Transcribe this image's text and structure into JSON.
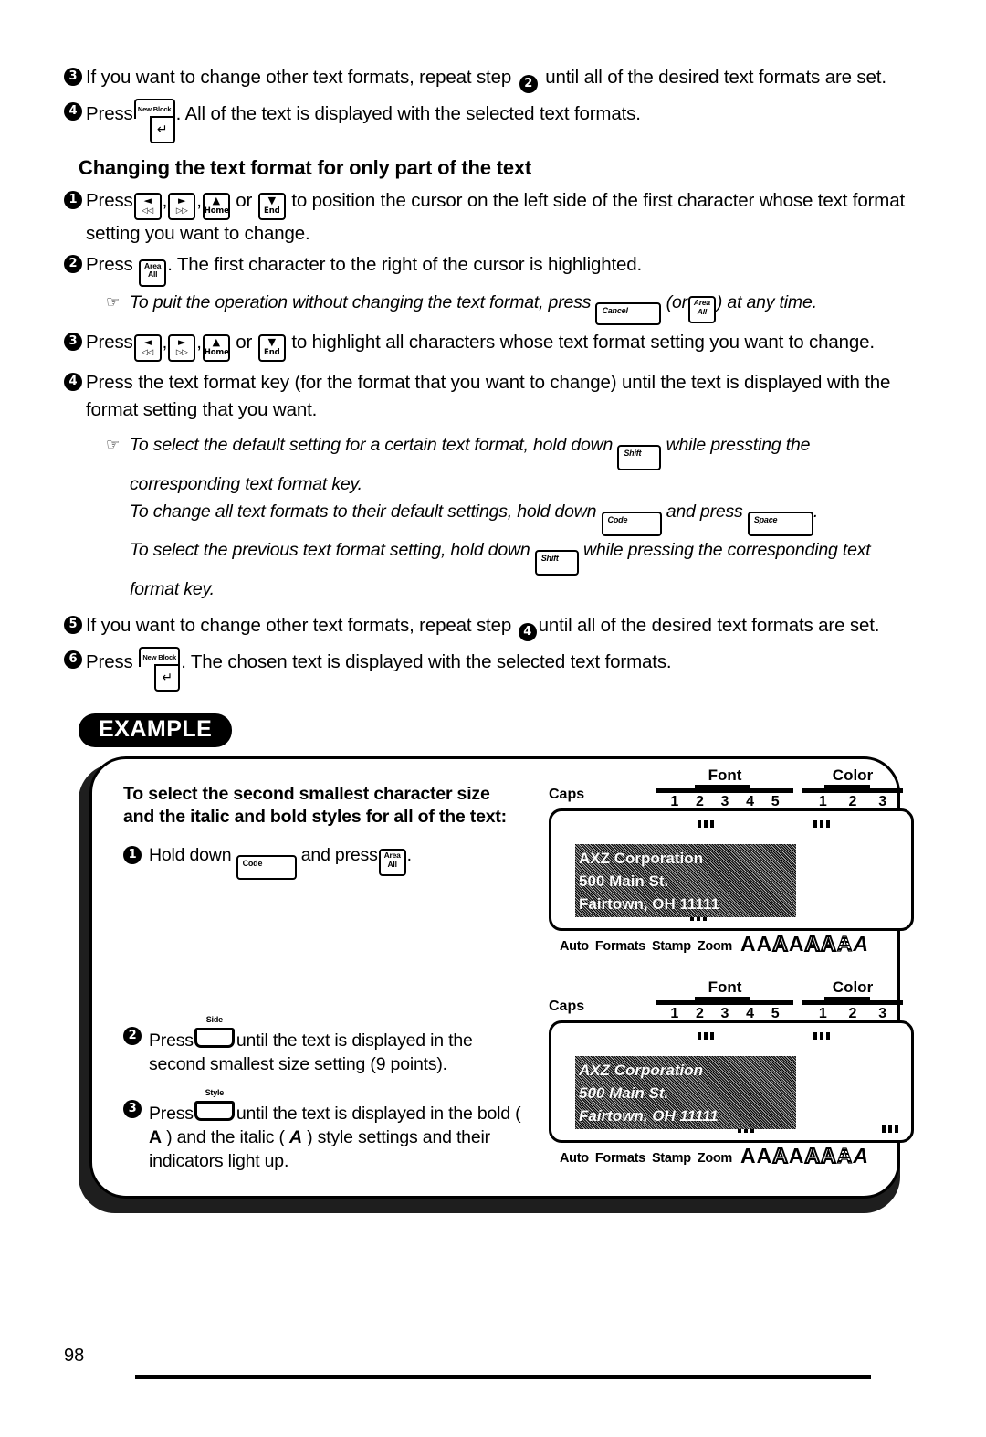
{
  "page": {
    "number": "98"
  },
  "keys": {
    "new_block": {
      "label": "New Block",
      "glyph": "↵"
    },
    "area_all": {
      "line1": "Area",
      "line2": "All"
    },
    "cursor_left": {
      "tri": "◄",
      "sub": "◁◁"
    },
    "cursor_right": {
      "tri": "►",
      "sub": "▷▷"
    },
    "cursor_up": {
      "tri": "▲",
      "sub": "Home"
    },
    "cursor_down": {
      "tri": "▼",
      "sub": "End"
    },
    "cancel": {
      "label": "Cancel"
    },
    "shift": {
      "label": "Shift"
    },
    "code": {
      "label": "Code"
    },
    "space": {
      "label": "Space"
    },
    "side": {
      "label": "Side"
    },
    "style": {
      "label": "Style"
    }
  },
  "top_steps": [
    {
      "num": "3",
      "text_before": "If you want to change other text formats, repeat step",
      "text_after": "until all of the desired text formats are set."
    },
    {
      "num": "4",
      "text_before": "Press",
      "text_after": ".  All of the text is displayed with the selected text formats."
    }
  ],
  "section": {
    "heading": "Changing the text format for only part of the text",
    "steps": [
      {
        "num": "1",
        "lead": "Press",
        "mid": "or",
        "tail": "to position the cursor on the left side of the first character whose text format setting you want to change."
      },
      {
        "num": "2",
        "lead": "Press",
        "tail": ".  The first character to the right of the cursor is highlighted."
      },
      {
        "num": "3",
        "lead": "Press",
        "mid": "or",
        "tail": "to highlight all characters whose text format setting you want to change."
      },
      {
        "num": "4",
        "text": "Press the text format key (for the format that you want to change) until the text is displayed with the format setting that you want."
      },
      {
        "num": "5",
        "text_before": "If you want to change other text formats, repeat step",
        "text_after": "until all of the desired text formats are set."
      },
      {
        "num": "6",
        "text_before": "Press",
        "text_after": ".  The chosen text is displayed with the selected text formats."
      }
    ],
    "notes": {
      "quit": {
        "part1": "To puit the operation without changing the text format, press",
        "part2": "(or",
        "part3": ") at any time."
      },
      "default": {
        "part1": "To select the default setting for a certain text format, hold down",
        "part2": "while pressting the corresponding text format key."
      },
      "all_defaults": {
        "part1": "To change all text formats to their default settings, hold down",
        "part2": "and press",
        "part3": "."
      },
      "previous": {
        "part1": "To select the previous text format setting, hold down",
        "part2": "while pressing the corresponding text format key."
      }
    }
  },
  "example": {
    "badge": "EXAMPLE",
    "title_line1": "To select the second smallest character size",
    "title_line2": "and the italic and bold styles for all of the text:",
    "steps": [
      {
        "num": "1",
        "part1": "Hold down",
        "part2": "and press",
        "part3": "."
      },
      {
        "num": "2",
        "part1": "Press",
        "part2": "until the text is displayed in the second smallest size setting (9 points)."
      },
      {
        "num": "3",
        "part1": "Press",
        "part2": "until the text is displayed in the bold (",
        "bold_a": "A",
        "part3": ") and the italic (",
        "italic_a": "A",
        "part4": ") style settings and their indicators light up."
      }
    ],
    "lcd": {
      "caps_label": "Caps",
      "font_scale": {
        "title": "Font",
        "numbers": [
          "1",
          "2",
          "3",
          "4",
          "5"
        ]
      },
      "color_scale": {
        "title": "Color",
        "numbers": [
          "1",
          "2",
          "3"
        ]
      },
      "screen_lines": [
        "AXZ Corporation",
        "500 Main St.",
        "Fairtown, OH 11111"
      ],
      "bottom_labels": [
        "Auto",
        "Formats",
        "Stamp",
        "Zoom"
      ],
      "style_glyphs": [
        "A",
        "A",
        "A",
        "A",
        "A",
        "A",
        "A",
        "A"
      ]
    }
  }
}
